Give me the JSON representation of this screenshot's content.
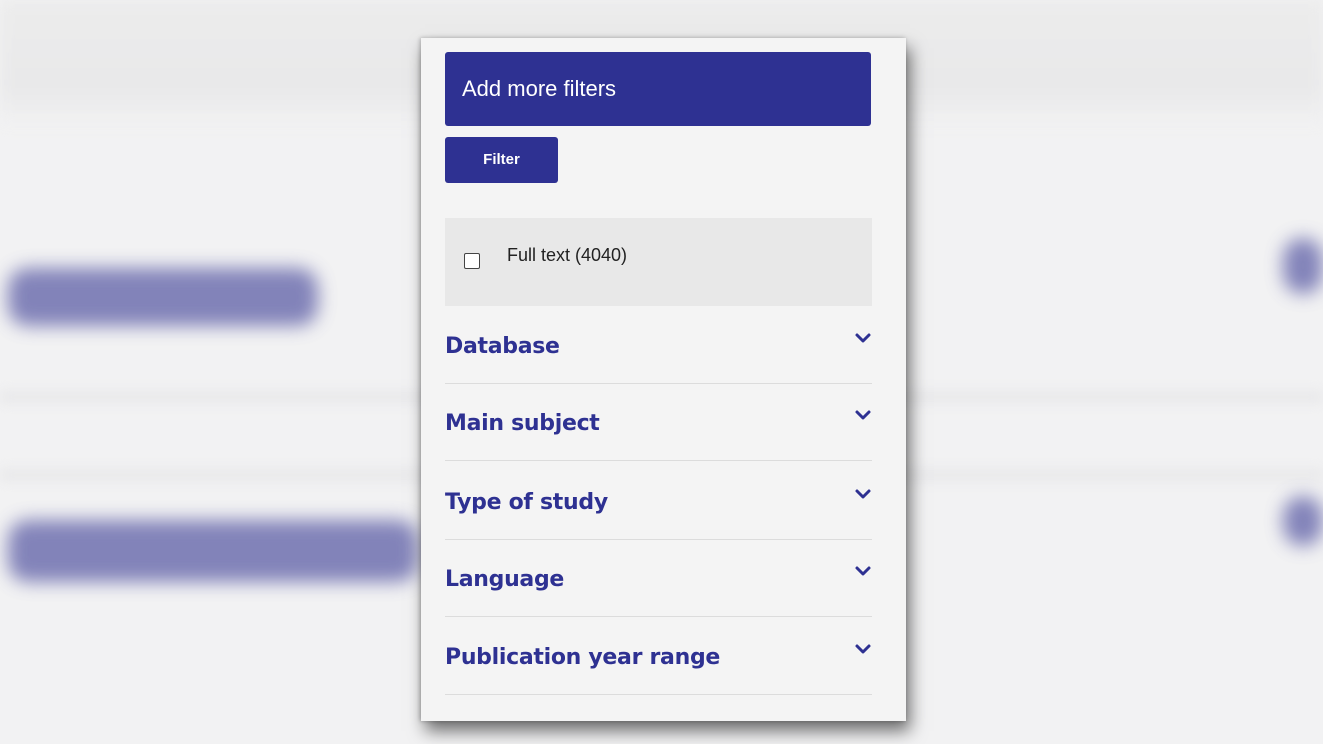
{
  "panel": {
    "add_filters_label": "Add more filters",
    "filter_button_label": "Filter",
    "full_text_label": "Full text (4040)",
    "full_text_checked": false,
    "facets": [
      {
        "label": "Database",
        "icon": "chevron-down-icon"
      },
      {
        "label": "Main subject",
        "icon": "chevron-down-icon"
      },
      {
        "label": "Type of study",
        "icon": "chevron-down-icon"
      },
      {
        "label": "Language",
        "icon": "chevron-down-icon"
      },
      {
        "label": "Publication year range",
        "icon": "chevron-down-icon"
      }
    ]
  },
  "colors": {
    "accent": "#2e3192",
    "panel_bg": "#f4f4f4",
    "fulltext_bg": "#e8e8e8",
    "page_bg": "#f2f2f3"
  }
}
